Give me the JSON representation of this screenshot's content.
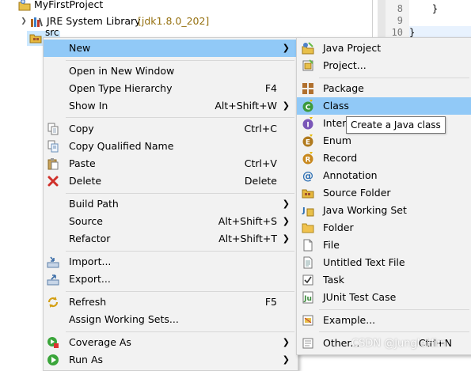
{
  "explorer": {
    "project_name": "MyFirstProject",
    "jre_label": "JRE System Library",
    "jre_decoration": "[jdk1.8.0_202]",
    "src_label": "src"
  },
  "editor": {
    "lines": [
      {
        "num": "8",
        "code": "    }"
      },
      {
        "num": "9",
        "code": ""
      },
      {
        "num": "10",
        "code": "}"
      }
    ]
  },
  "context_menu": {
    "items": [
      {
        "label": "New",
        "shortcut": "",
        "submenu": true,
        "icon": "",
        "highlighted": true
      },
      {
        "label": "Open in New Window",
        "shortcut": "",
        "submenu": false,
        "icon": ""
      },
      {
        "label": "Open Type Hierarchy",
        "shortcut": "F4",
        "submenu": false,
        "icon": ""
      },
      {
        "label": "Show In",
        "shortcut": "Alt+Shift+W",
        "submenu": true,
        "icon": ""
      },
      {
        "label": "Copy",
        "shortcut": "Ctrl+C",
        "submenu": false,
        "icon": "copy-icon"
      },
      {
        "label": "Copy Qualified Name",
        "shortcut": "",
        "submenu": false,
        "icon": "copy-qualified-name-icon"
      },
      {
        "label": "Paste",
        "shortcut": "Ctrl+V",
        "submenu": false,
        "icon": "paste-icon"
      },
      {
        "label": "Delete",
        "shortcut": "Delete",
        "submenu": false,
        "icon": "delete-icon"
      },
      {
        "label": "Build Path",
        "shortcut": "",
        "submenu": true,
        "icon": ""
      },
      {
        "label": "Source",
        "shortcut": "Alt+Shift+S",
        "submenu": true,
        "icon": ""
      },
      {
        "label": "Refactor",
        "shortcut": "Alt+Shift+T",
        "submenu": true,
        "icon": ""
      },
      {
        "label": "Import...",
        "shortcut": "",
        "submenu": false,
        "icon": "import-icon"
      },
      {
        "label": "Export...",
        "shortcut": "",
        "submenu": false,
        "icon": "export-icon"
      },
      {
        "label": "Refresh",
        "shortcut": "F5",
        "submenu": false,
        "icon": "refresh-icon"
      },
      {
        "label": "Assign Working Sets...",
        "shortcut": "",
        "submenu": false,
        "icon": ""
      },
      {
        "label": "Coverage As",
        "shortcut": "",
        "submenu": true,
        "icon": "coverage-icon"
      },
      {
        "label": "Run As",
        "shortcut": "",
        "submenu": true,
        "icon": "run-icon"
      }
    ]
  },
  "new_submenu": {
    "items": [
      {
        "label": "Java Project",
        "shortcut": "",
        "icon": "java-project-icon"
      },
      {
        "label": "Project...",
        "shortcut": "",
        "icon": "project-icon"
      },
      {
        "label": "Package",
        "shortcut": "",
        "icon": "package-icon"
      },
      {
        "label": "Class",
        "shortcut": "",
        "icon": "class-icon",
        "highlighted": true
      },
      {
        "label": "Interface",
        "shortcut": "",
        "icon": "interface-icon"
      },
      {
        "label": "Enum",
        "shortcut": "",
        "icon": "enum-icon"
      },
      {
        "label": "Record",
        "shortcut": "",
        "icon": "record-icon"
      },
      {
        "label": "Annotation",
        "shortcut": "",
        "icon": "annotation-icon"
      },
      {
        "label": "Source Folder",
        "shortcut": "",
        "icon": "source-folder-icon"
      },
      {
        "label": "Java Working Set",
        "shortcut": "",
        "icon": "java-working-set-icon"
      },
      {
        "label": "Folder",
        "shortcut": "",
        "icon": "folder-icon"
      },
      {
        "label": "File",
        "shortcut": "",
        "icon": "file-icon"
      },
      {
        "label": "Untitled Text File",
        "shortcut": "",
        "icon": "untitled-text-file-icon"
      },
      {
        "label": "Task",
        "shortcut": "",
        "icon": "task-icon"
      },
      {
        "label": "JUnit Test Case",
        "shortcut": "",
        "icon": "junit-test-case-icon"
      },
      {
        "label": "Example...",
        "shortcut": "",
        "icon": "example-icon"
      },
      {
        "label": "Other...",
        "shortcut": "Ctrl+N",
        "icon": "other-icon"
      }
    ]
  },
  "tooltip": {
    "text": "Create a Java class"
  },
  "watermark": {
    "text": "CSDN @JungleHim"
  }
}
